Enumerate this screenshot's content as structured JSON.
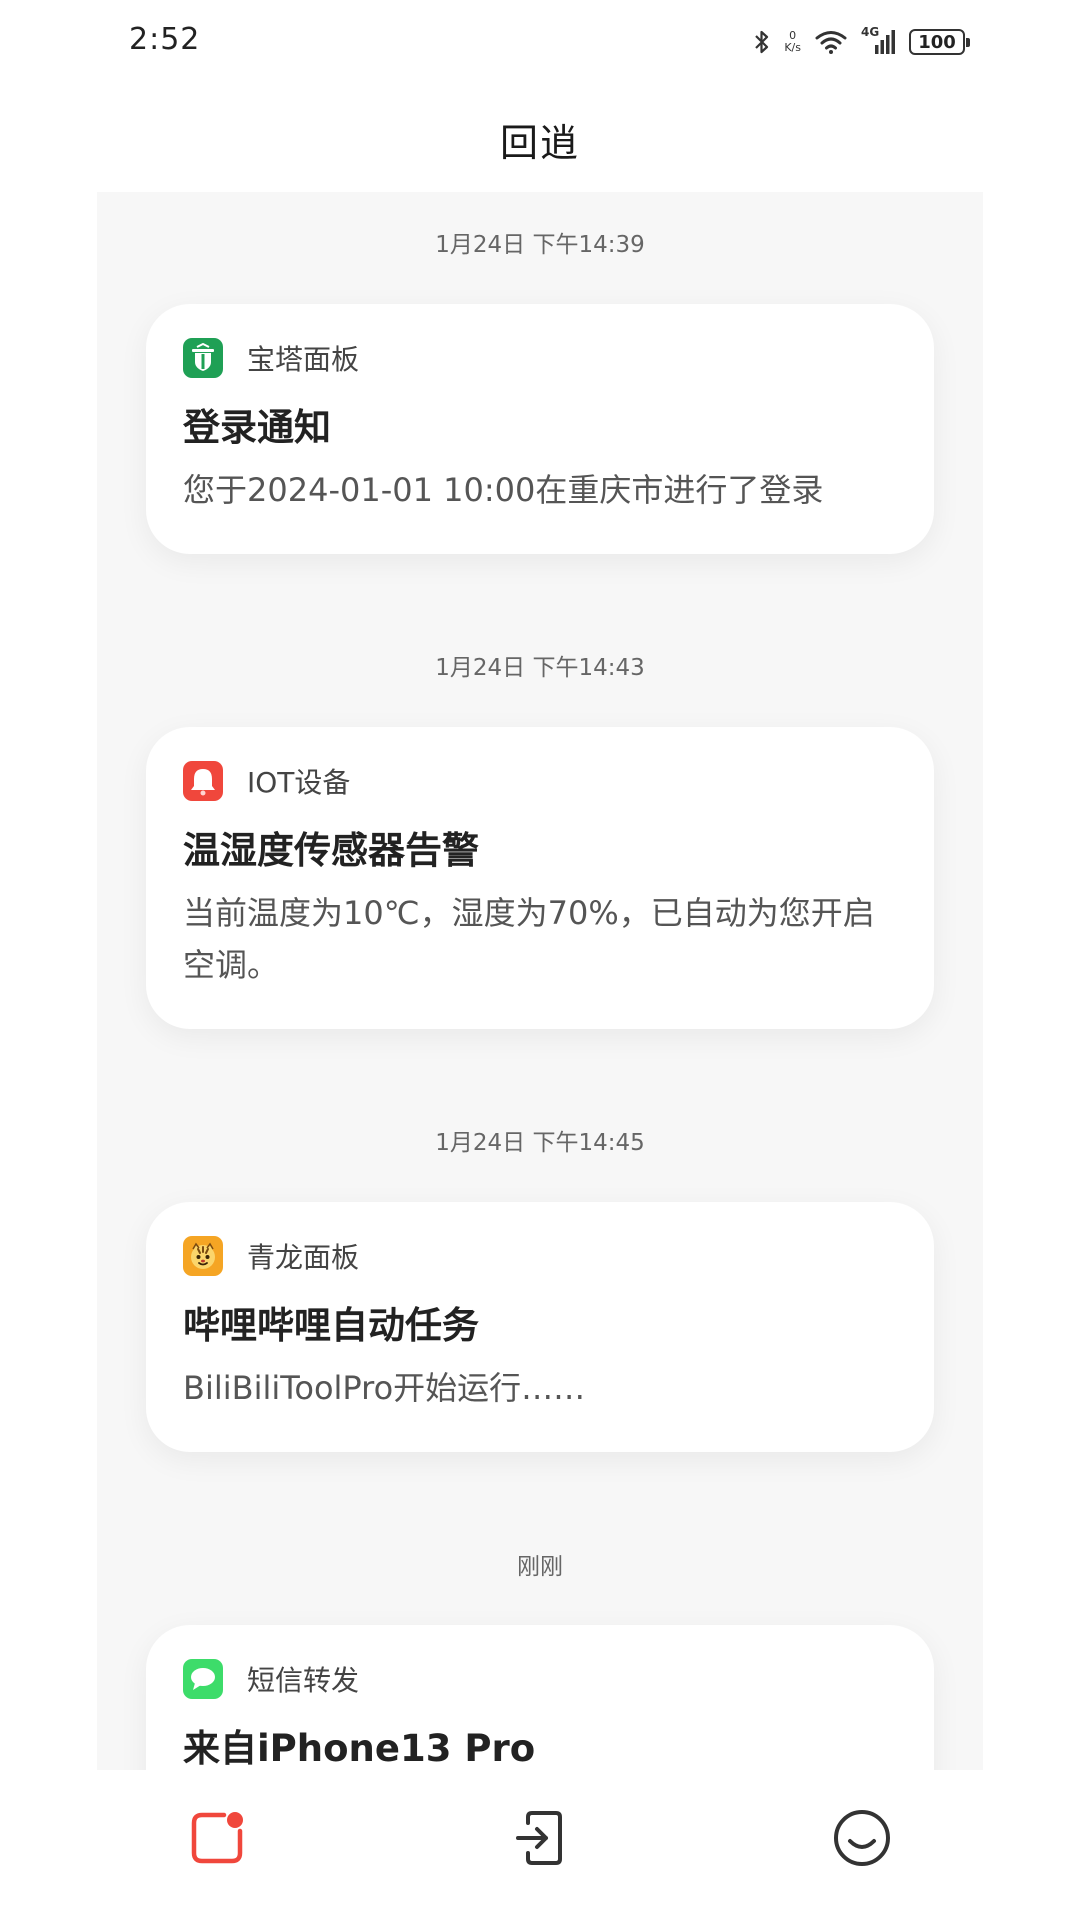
{
  "status_bar": {
    "time": "2:52",
    "net_speed_value": "0",
    "net_speed_unit": "K/s",
    "network_type": "4G",
    "battery": "100"
  },
  "header": {
    "title": "回逍"
  },
  "feed": [
    {
      "time": "1月24日 下午14:39",
      "app_name": "宝塔面板",
      "app_icon": "shield-icon",
      "app_color": "#1fa055",
      "title": "登录通知",
      "body": "您于2024-01-01 10:00在重庆市进行了登录"
    },
    {
      "time": "1月24日 下午14:43",
      "app_name": "IOT设备",
      "app_icon": "bell-icon",
      "app_color": "#f0473c",
      "title": "温湿度传感器告警",
      "body": "当前温度为10℃，湿度为70%，已自动为您开启空调。"
    },
    {
      "time": "1月24日 下午14:45",
      "app_name": "青龙面板",
      "app_icon": "tiger-icon",
      "app_color": "#f5a524",
      "title": "哔哩哔哩自动任务",
      "body": "BiliBiliToolPro开始运行……"
    },
    {
      "time": "刚刚",
      "app_name": "短信转发",
      "app_icon": "message-icon",
      "app_color": "#3ddc6a",
      "title": "来自iPhone13 Pro",
      "body": ""
    }
  ],
  "tab_bar": {
    "accent_color": "#f0473c",
    "tabs": [
      {
        "icon": "notification-icon",
        "active": true
      },
      {
        "icon": "exit-icon",
        "active": false
      },
      {
        "icon": "smile-icon",
        "active": false
      }
    ]
  }
}
